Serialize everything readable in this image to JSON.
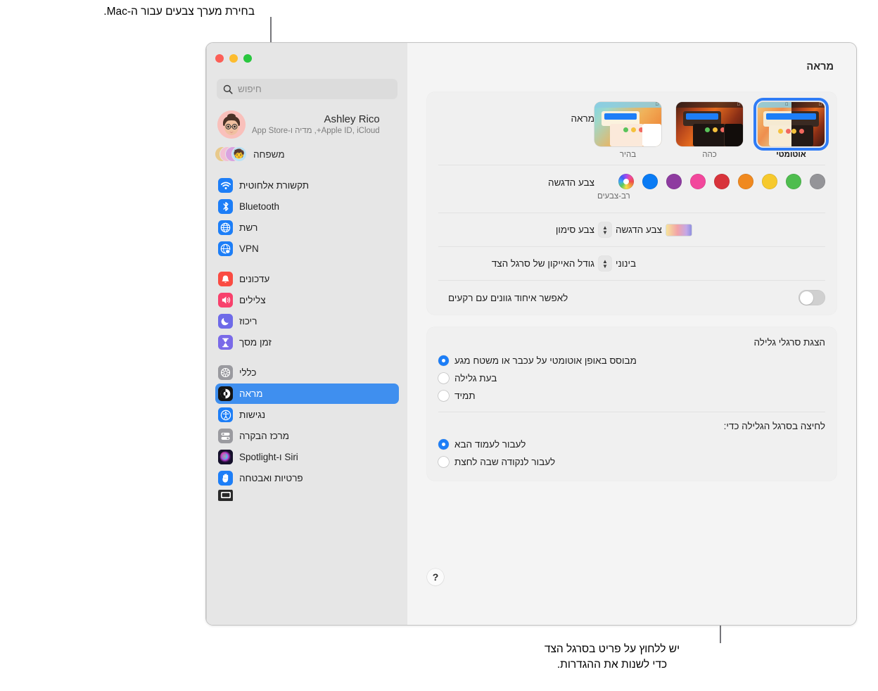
{
  "callouts": {
    "top": "בחירת מערך צבעים עבור ה-Mac.",
    "bottom": "יש ללחוץ על פריט בסרגל הצד\nכדי לשנות את ההגדרות."
  },
  "window": {
    "title": "מראה",
    "traffic_lights": [
      "close",
      "minimize",
      "zoom"
    ]
  },
  "sidebar": {
    "search": {
      "placeholder": "חיפוש",
      "icon": "search-icon"
    },
    "account": {
      "name": "Ashley Rico",
      "subtitle": "Apple ID, iCloud+, מדיה ו-App Store",
      "avatar": "memoji-avatar"
    },
    "family": {
      "label": "משפחה",
      "icon": "family-avatars"
    },
    "groups": [
      {
        "items": [
          {
            "label": "תקשורת אלחוטית",
            "icon": "wifi-icon",
            "color": "#1d7ef7",
            "selected": false
          },
          {
            "label": "Bluetooth",
            "icon": "bluetooth-icon",
            "color": "#1d7ef7",
            "selected": false
          },
          {
            "label": "רשת",
            "icon": "globe-icon",
            "color": "#1d7ef7",
            "selected": false
          },
          {
            "label": "VPN",
            "icon": "vpn-globe-icon",
            "color": "#1d7ef7",
            "selected": false
          }
        ]
      },
      {
        "items": [
          {
            "label": "עדכונים",
            "icon": "bell-icon",
            "color": "#fa4b42",
            "selected": false
          },
          {
            "label": "צלילים",
            "icon": "speaker-icon",
            "color": "#f8416c",
            "selected": false
          },
          {
            "label": "ריכוז",
            "icon": "moon-icon",
            "color": "#6e6ae8",
            "selected": false
          },
          {
            "label": "זמן מסך",
            "icon": "hourglass-icon",
            "color": "#7a6ae8",
            "selected": false
          }
        ]
      },
      {
        "items": [
          {
            "label": "כללי",
            "icon": "gear-icon",
            "color": "#9a9a9f",
            "selected": false
          },
          {
            "label": "מראה",
            "icon": "appearance-icon",
            "color": "#1a1a1a",
            "selected": true
          },
          {
            "label": "נגישות",
            "icon": "accessibility-icon",
            "color": "#1d7ef7",
            "selected": false
          },
          {
            "label": "מרכז הבקרה",
            "icon": "control-center-icon",
            "color": "#9a9a9f",
            "selected": false
          },
          {
            "label": "Siri ו-Spotlight",
            "icon": "siri-icon",
            "color": "#2b2b6e",
            "selected": false
          },
          {
            "label": "פרטיות ואבטחה",
            "icon": "hand-icon",
            "color": "#1d7ef7",
            "selected": false
          }
        ]
      }
    ],
    "partial_item": {
      "icon": "desktop-dock-icon",
      "color": "#2a2a2a"
    }
  },
  "content": {
    "appearance_row": {
      "label": "מראה",
      "options": [
        {
          "label": "אוטומטי",
          "theme": "auto",
          "selected": true
        },
        {
          "label": "כהה",
          "theme": "dark",
          "selected": false
        },
        {
          "label": "בהיר",
          "theme": "light",
          "selected": false
        }
      ]
    },
    "accent_row": {
      "label": "צבע הדגשה",
      "caption": "רב-צבעים",
      "swatches": [
        {
          "name": "graphite",
          "color": "#949498",
          "selected": false
        },
        {
          "name": "green",
          "color": "#4fbd4f",
          "selected": false
        },
        {
          "name": "yellow",
          "color": "#f6c92d",
          "selected": false
        },
        {
          "name": "orange",
          "color": "#f0891f",
          "selected": false
        },
        {
          "name": "red",
          "color": "#d8333b",
          "selected": false
        },
        {
          "name": "pink",
          "color": "#f2479c",
          "selected": false
        },
        {
          "name": "purple",
          "color": "#8e3ba0",
          "selected": false
        },
        {
          "name": "blue",
          "color": "#0a7bf4",
          "selected": false
        },
        {
          "name": "multicolor",
          "color": "multi",
          "selected": true
        }
      ]
    },
    "highlight_row": {
      "label": "צבע סימון",
      "value": "צבע הדגשה"
    },
    "sidebar_icon_row": {
      "label": "גודל האייקון של סרגל הצד",
      "value": "בינוני"
    },
    "wallpaper_tint_row": {
      "label": "לאפשר איחוד גוונים עם רקעים",
      "toggle_on": false
    },
    "scrollbars": {
      "title": "הצגת סרגלי גלילה",
      "options": [
        {
          "label": "מבוסס באופן אוטומטי על עכבר או משטח מגע",
          "selected": true
        },
        {
          "label": "בעת גלילה",
          "selected": false
        },
        {
          "label": "תמיד",
          "selected": false
        }
      ]
    },
    "scroll_click": {
      "title": "לחיצה בסרגל הגלילה כדי:",
      "options": [
        {
          "label": "לעבור לעמוד הבא",
          "selected": true
        },
        {
          "label": "לעבור לנקודה שבה לחצת",
          "selected": false
        }
      ]
    },
    "help_button": {
      "label": "?"
    }
  }
}
